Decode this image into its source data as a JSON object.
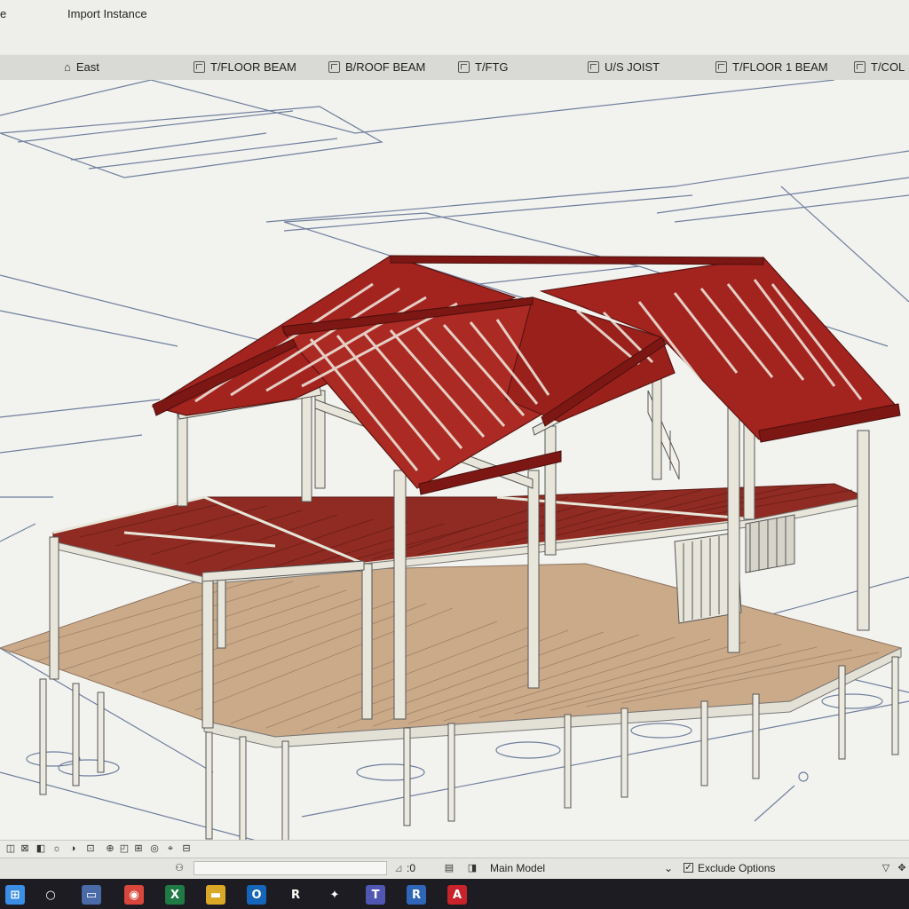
{
  "top_bar": {
    "left_fragment": "e",
    "import_instance_label": "Import Instance"
  },
  "view_tabs": [
    {
      "label": "East",
      "icon": "home-icon"
    },
    {
      "label": "T/FLOOR BEAM",
      "icon": "view-icon"
    },
    {
      "label": "B/ROOF BEAM",
      "icon": "view-icon"
    },
    {
      "label": "T/FTG",
      "icon": "view-icon"
    },
    {
      "label": "U/S JOIST",
      "icon": "view-icon"
    },
    {
      "label": "T/FLOOR 1 BEAM",
      "icon": "view-icon"
    },
    {
      "label": "T/COL",
      "icon": "view-icon"
    }
  ],
  "status_bar": {
    "filter_count": ":0",
    "model_label": "Main Model",
    "exclude_options_label": "Exclude Options",
    "exclude_options_checked": true,
    "checkmark": "✓"
  },
  "taskbar": {
    "apps": [
      {
        "name": "windows-start-icon",
        "glyph": "⊞",
        "color": "#3a8ee6"
      },
      {
        "name": "search-icon",
        "glyph": "○",
        "color": "#1c1c22"
      },
      {
        "name": "task-view-icon",
        "glyph": "▭",
        "color": "#4b6aa8"
      },
      {
        "name": "chrome-icon",
        "glyph": "◉",
        "color": "#d9463c"
      },
      {
        "name": "excel-icon",
        "glyph": "X",
        "color": "#1f7a45"
      },
      {
        "name": "file-explorer-icon",
        "glyph": "▬",
        "color": "#d8a826"
      },
      {
        "name": "outlook-icon",
        "glyph": "O",
        "color": "#1565b8"
      },
      {
        "name": "recap-icon",
        "glyph": "R",
        "color": "#1c1c22"
      },
      {
        "name": "autodesk-app-icon",
        "glyph": "✦",
        "color": "#1c1c22"
      },
      {
        "name": "teams-icon",
        "glyph": "T",
        "color": "#5057b3"
      },
      {
        "name": "revit-icon",
        "glyph": "R",
        "color": "#2f66b8"
      },
      {
        "name": "autocad-icon",
        "glyph": "A",
        "color": "#c8232b"
      }
    ]
  },
  "colors": {
    "roof": "#a3231f",
    "roof_dark": "#7d1714",
    "roof_light": "#bf3a30",
    "column": "#e8e6da",
    "deck": "#c9a88a",
    "floor": "#8e2a22",
    "wire": "#5a6b8c"
  }
}
